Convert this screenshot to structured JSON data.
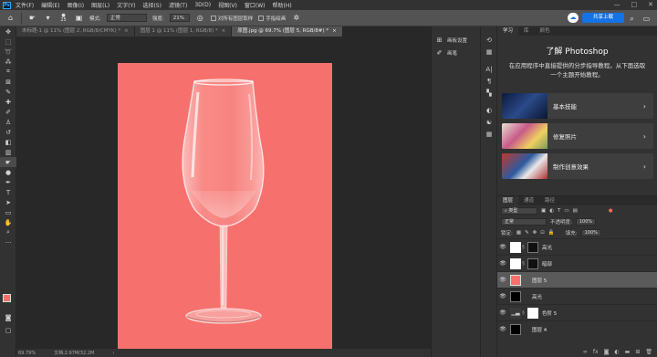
{
  "menu": {
    "items": [
      "文件(F)",
      "编辑(E)",
      "图像(I)",
      "图层(L)",
      "文字(Y)",
      "选择(S)",
      "滤镜(T)",
      "3D(D)",
      "视图(V)",
      "窗口(W)",
      "帮助(H)"
    ],
    "win_min": "—",
    "win_max": "□",
    "win_close": "✕"
  },
  "options": {
    "brush_size": "25",
    "mode_label": "模式:",
    "mode_value": "正常",
    "strength_label": "强度:",
    "strength_value": "21%",
    "sample_all": "对所有图层取样",
    "finger_paint": "手指绘画",
    "share_label": "共享上载"
  },
  "tabs": [
    {
      "label": "未标题-1 @ 11% (图层 2, RGB/8/CMYK) *",
      "close": "×"
    },
    {
      "label": "图层 1 @ 11% (图层 1, RGB/8) *",
      "close": "×"
    },
    {
      "label": "原图.jpg @ 69.7% (图层 5, RGB/8#) *",
      "close": "×"
    }
  ],
  "status": {
    "zoom": "69.79%",
    "doc": "文档:2.97M/32.2M"
  },
  "mini_panel": {
    "item1": "画板设置",
    "item2": "画笔"
  },
  "learn": {
    "tabs": [
      "学习",
      "库",
      "颜色"
    ],
    "title": "了解 Photoshop",
    "desc": "在应用程序中直接提供的分步指导教程。从下面选取一个主题开始教程。",
    "cards": [
      "基本技能",
      "修复照片",
      "制作创意效果"
    ],
    "arrow": "›"
  },
  "layers": {
    "tabs": [
      "图层",
      "通道",
      "路径"
    ],
    "filter_value": "类型",
    "blend_mode": "正常",
    "opacity_label": "不透明度:",
    "opacity_value": "100%",
    "lock_label": "锁定:",
    "fill_label": "填充:",
    "fill_value": "100%",
    "items": [
      {
        "name": "高光",
        "thumb": "white-mask",
        "selected": false
      },
      {
        "name": "暗部",
        "thumb": "white-mask",
        "selected": false
      },
      {
        "name": "图层 5",
        "thumb": "#f6716d",
        "selected": true
      },
      {
        "name": "高光",
        "thumb": "black-mask",
        "selected": false
      },
      {
        "name": "色阶 5",
        "thumb": "adjust",
        "selected": false
      },
      {
        "name": "图层 4",
        "thumb": "black-mask",
        "selected": false
      }
    ],
    "footer_icons": [
      "link-icon",
      "fx-icon",
      "mask-icon",
      "adjust-icon",
      "folder-icon",
      "new-layer-icon",
      "trash-icon"
    ]
  },
  "colors": {
    "canvas_bg": "#f6716d",
    "accent": "#1473e6"
  }
}
